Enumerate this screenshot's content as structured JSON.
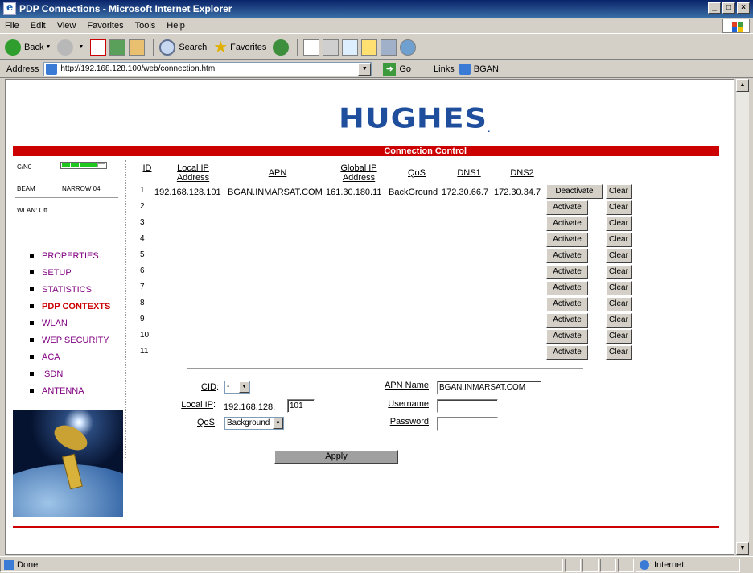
{
  "window": {
    "title": "PDP Connections - Microsoft Internet Explorer"
  },
  "menu": [
    "File",
    "Edit",
    "View",
    "Favorites",
    "Tools",
    "Help"
  ],
  "toolbar": {
    "back": "Back",
    "search": "Search",
    "favorites": "Favorites"
  },
  "address": {
    "label": "Address",
    "url": "http://192.168.128.100/web/connection.htm",
    "go": "Go",
    "links": "Links",
    "link_bgan": "BGAN"
  },
  "status": {
    "text": "Done",
    "zone": "Internet"
  },
  "page": {
    "logo": "HUGHES",
    "logo_mark": ".",
    "section_title": "Connection Control",
    "sidebar": {
      "cn0_label": "C/N0",
      "signal_level": 0.8,
      "beam_label": "BEAM",
      "beam_value": "NARROW 04",
      "wlan_status": "WLAN: Off",
      "nav": [
        {
          "label": "PROPERTIES",
          "active": false
        },
        {
          "label": "SETUP",
          "active": false
        },
        {
          "label": "STATISTICS",
          "active": false
        },
        {
          "label": "PDP CONTEXTS",
          "active": true
        },
        {
          "label": "WLAN",
          "active": false
        },
        {
          "label": "WEP SECURITY",
          "active": false
        },
        {
          "label": "ACA",
          "active": false
        },
        {
          "label": "ISDN",
          "active": false
        },
        {
          "label": "ANTENNA",
          "active": false
        }
      ]
    },
    "table": {
      "headers": {
        "id": "ID",
        "local_ip": "Local IP Address",
        "apn": "APN",
        "global_ip": "Global IP Address",
        "qos": "QoS",
        "dns1": "DNS1",
        "dns2": "DNS2"
      },
      "rows": [
        {
          "id": "1",
          "local_ip": "192.168.128.101",
          "apn": "BGAN.INMARSAT.COM",
          "global_ip": "161.30.180.11",
          "qos": "BackGround",
          "dns1": "172.30.66.7",
          "dns2": "172.30.34.7",
          "action": "Deactivate",
          "clear": "Clear"
        },
        {
          "id": "2",
          "action": "Activate",
          "clear": "Clear"
        },
        {
          "id": "3",
          "action": "Activate",
          "clear": "Clear"
        },
        {
          "id": "4",
          "action": "Activate",
          "clear": "Clear"
        },
        {
          "id": "5",
          "action": "Activate",
          "clear": "Clear"
        },
        {
          "id": "6",
          "action": "Activate",
          "clear": "Clear"
        },
        {
          "id": "7",
          "action": "Activate",
          "clear": "Clear"
        },
        {
          "id": "8",
          "action": "Activate",
          "clear": "Clear"
        },
        {
          "id": "9",
          "action": "Activate",
          "clear": "Clear"
        },
        {
          "id": "10",
          "action": "Activate",
          "clear": "Clear"
        },
        {
          "id": "11",
          "action": "Activate",
          "clear": "Clear"
        }
      ]
    },
    "form": {
      "cid_label": "CID",
      "cid_value": "-",
      "local_ip_label": "Local IP",
      "local_ip_prefix": "192.168.128.",
      "local_ip_suffix": "101",
      "qos_label": "QoS",
      "qos_value": "Background",
      "apn_label": "APN Name",
      "apn_value": "BGAN.INMARSAT.COM",
      "username_label": "Username",
      "username_value": "",
      "password_label": "Password",
      "password_value": "",
      "colon": ":",
      "apply": "Apply"
    }
  }
}
